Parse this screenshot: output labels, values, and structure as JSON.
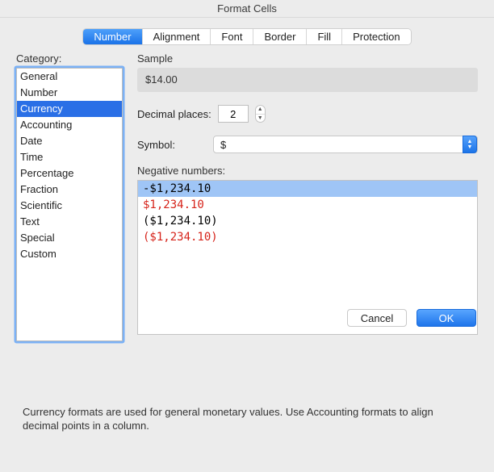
{
  "window": {
    "title": "Format Cells"
  },
  "tabs": {
    "items": [
      {
        "label": "Number",
        "selected": true
      },
      {
        "label": "Alignment",
        "selected": false
      },
      {
        "label": "Font",
        "selected": false
      },
      {
        "label": "Border",
        "selected": false
      },
      {
        "label": "Fill",
        "selected": false
      },
      {
        "label": "Protection",
        "selected": false
      }
    ]
  },
  "category": {
    "label": "Category:",
    "items": [
      {
        "label": "General",
        "selected": false
      },
      {
        "label": "Number",
        "selected": false
      },
      {
        "label": "Currency",
        "selected": true
      },
      {
        "label": "Accounting",
        "selected": false
      },
      {
        "label": "Date",
        "selected": false
      },
      {
        "label": "Time",
        "selected": false
      },
      {
        "label": "Percentage",
        "selected": false
      },
      {
        "label": "Fraction",
        "selected": false
      },
      {
        "label": "Scientific",
        "selected": false
      },
      {
        "label": "Text",
        "selected": false
      },
      {
        "label": "Special",
        "selected": false
      },
      {
        "label": "Custom",
        "selected": false
      }
    ]
  },
  "sample": {
    "label": "Sample",
    "value": "$14.00"
  },
  "decimal": {
    "label": "Decimal places:",
    "value": "2"
  },
  "symbol": {
    "label": "Symbol:",
    "value": "$"
  },
  "negative": {
    "label": "Negative numbers:",
    "items": [
      {
        "text": "-$1,234.10",
        "color": "#000000",
        "selected": true
      },
      {
        "text": "$1,234.10",
        "color": "#d6231a",
        "selected": false
      },
      {
        "text": "($1,234.10)",
        "color": "#000000",
        "selected": false
      },
      {
        "text": "($1,234.10)",
        "color": "#d6231a",
        "selected": false
      }
    ]
  },
  "hint": "Currency formats are used for general monetary values.  Use Accounting formats to align decimal points in a column.",
  "buttons": {
    "cancel": "Cancel",
    "ok": "OK"
  }
}
